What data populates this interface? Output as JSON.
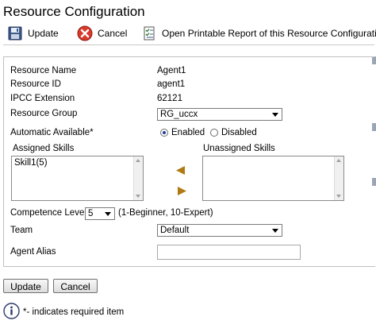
{
  "page": {
    "title": "Resource Configuration"
  },
  "toolbar": {
    "update_label": "Update",
    "cancel_label": "Cancel",
    "report_label": "Open Printable Report of this Resource Configuration"
  },
  "form": {
    "resource_name": {
      "label": "Resource Name",
      "value": "Agent1"
    },
    "resource_id": {
      "label": "Resource ID",
      "value": "agent1"
    },
    "ipcc_extension": {
      "label": "IPCC Extension",
      "value": "62121"
    },
    "resource_group": {
      "label": "Resource Group",
      "value": "RG_uccx"
    },
    "automatic_available": {
      "label": "Automatic Available*",
      "options": [
        "Enabled",
        "Disabled"
      ],
      "selected": "Enabled"
    },
    "assigned_skills": {
      "label": "Assigned Skills",
      "items": [
        "Skill1(5)"
      ]
    },
    "unassigned_skills": {
      "label": "Unassigned Skills",
      "items": []
    },
    "competence_level": {
      "label": "Competence Level",
      "value": "5",
      "hint": "(1-Beginner, 10-Expert)"
    },
    "team": {
      "label": "Team",
      "value": "Default"
    },
    "agent_alias": {
      "label": "Agent Alias",
      "value": ""
    }
  },
  "bottom": {
    "update_label": "Update",
    "cancel_label": "Cancel",
    "note": "*- indicates required item"
  },
  "icons": {
    "update": "floppy-disk-icon",
    "cancel": "red-x-circle-icon",
    "report": "checklist-report-icon",
    "move_left": "left-arrow-icon",
    "move_right": "right-arrow-icon",
    "info": "info-icon"
  },
  "colors": {
    "arrow": "#b07a12",
    "cancel_red": "#d93a2b",
    "info_border": "#2a3a6a"
  }
}
